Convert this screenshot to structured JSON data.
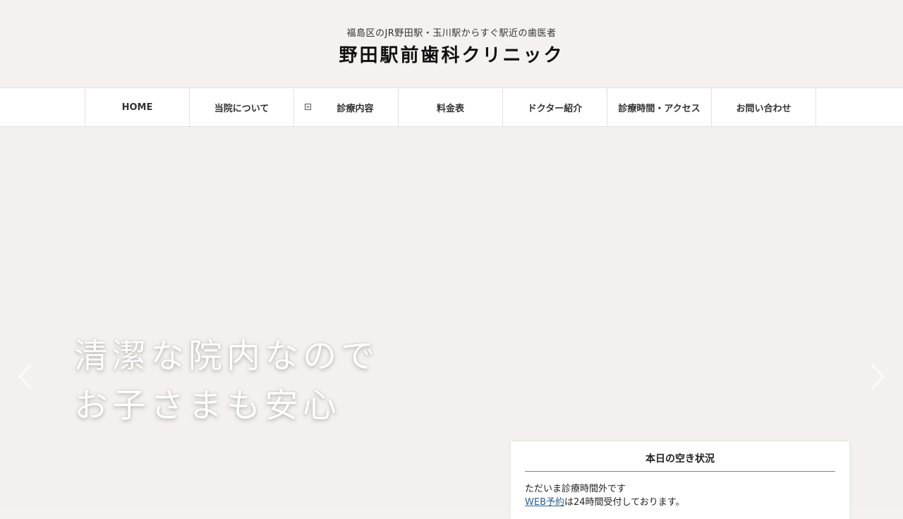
{
  "header": {
    "tagline": "福島区のJR野田駅・玉川駅からすぐ駅近の歯医者",
    "site_title": "野田駅前歯科クリニック"
  },
  "nav": {
    "items": [
      {
        "label": "HOME"
      },
      {
        "label": "当院について"
      },
      {
        "label": "診療内容",
        "has_submenu": true
      },
      {
        "label": "料金表"
      },
      {
        "label": "ドクター紹介"
      },
      {
        "label": "診療時間・アクセス"
      },
      {
        "label": "お問い合わせ"
      }
    ]
  },
  "hero": {
    "line1": "清潔な院内なので",
    "line2": "お子さまも安心",
    "prev_icon": "chevron-left-icon",
    "next_icon": "chevron-right-icon"
  },
  "availability": {
    "title": "本日の空き状況",
    "status": "ただいま診療時間外です",
    "web_link": "WEB予約",
    "web_suffix": "は24時間受付しております。"
  },
  "colors": {
    "background": "#f4f1ee",
    "nav_background": "#ffffff",
    "link": "#2c5f8f"
  }
}
